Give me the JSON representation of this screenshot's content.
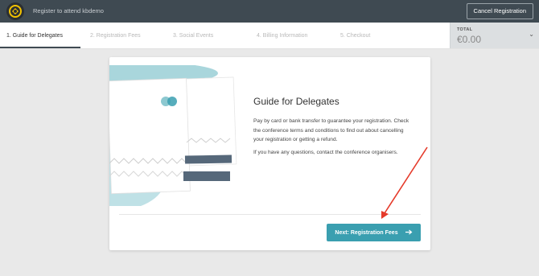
{
  "header": {
    "title": "Register to attend kbdemo",
    "cancel_label": "Cancel Registration"
  },
  "steps": [
    {
      "label": "1.  Guide for Delegates",
      "active": true
    },
    {
      "label": "2.  Registration Fees",
      "active": false
    },
    {
      "label": "3.  Social Events",
      "active": false
    },
    {
      "label": "4.  Billing Information",
      "active": false
    },
    {
      "label": "5.  Checkout",
      "active": false
    }
  ],
  "total": {
    "label": "TOTAL",
    "amount": "€0.00"
  },
  "main": {
    "title": "Guide for Delegates",
    "paragraph1": "Pay by card or bank transfer to guarantee your registration. Check the conference terms and conditions to find out about cancelling your registration or getting a refund.",
    "paragraph2": "If you have any questions, contact the conference organisers.",
    "next_label": "Next: Registration Fees"
  },
  "colors": {
    "topbar": "#3f4a52",
    "accent": "#3a9fb0",
    "annotation_arrow": "#e53a2a"
  },
  "icons": [
    "logo-icon",
    "chevron-down-icon",
    "arrow-right-icon"
  ]
}
